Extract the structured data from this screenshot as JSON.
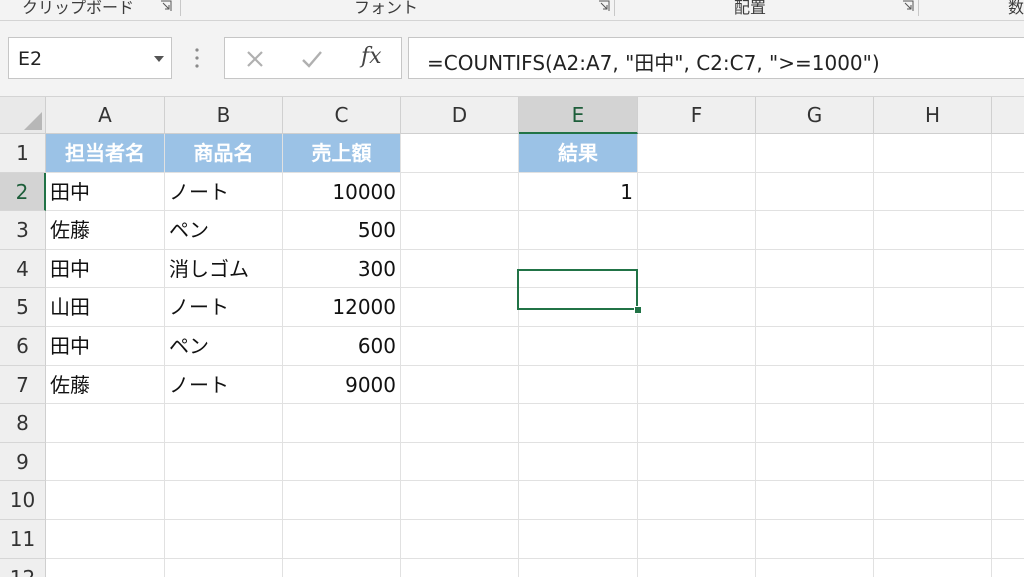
{
  "ribbon": {
    "groups": [
      "クリップボード",
      "フォント",
      "配置",
      "数"
    ]
  },
  "formula_bar": {
    "name_box": "E2",
    "fx_label": "fx",
    "formula": "=COUNTIFS(A2:A7, \"田中\", C2:C7, \">=1000\")"
  },
  "sheet": {
    "columns": [
      "A",
      "B",
      "C",
      "D",
      "E",
      "F",
      "G",
      "H"
    ],
    "rows": [
      "1",
      "2",
      "3",
      "4",
      "5",
      "6",
      "7",
      "8",
      "9",
      "10",
      "11",
      "12"
    ],
    "selected_cell": "E2",
    "header_fill": "#9bc2e6",
    "cells": {
      "A1": "担当者名",
      "B1": "商品名",
      "C1": "売上額",
      "E1": "結果",
      "A2": "田中",
      "B2": "ノート",
      "C2": "10000",
      "E2": "1",
      "A3": "佐藤",
      "B3": "ペン",
      "C3": "500",
      "A4": "田中",
      "B4": "消しゴム",
      "C4": "300",
      "A5": "山田",
      "B5": "ノート",
      "C5": "12000",
      "A6": "田中",
      "B6": "ペン",
      "C6": "600",
      "A7": "佐藤",
      "B7": "ノート",
      "C7": "9000"
    }
  }
}
